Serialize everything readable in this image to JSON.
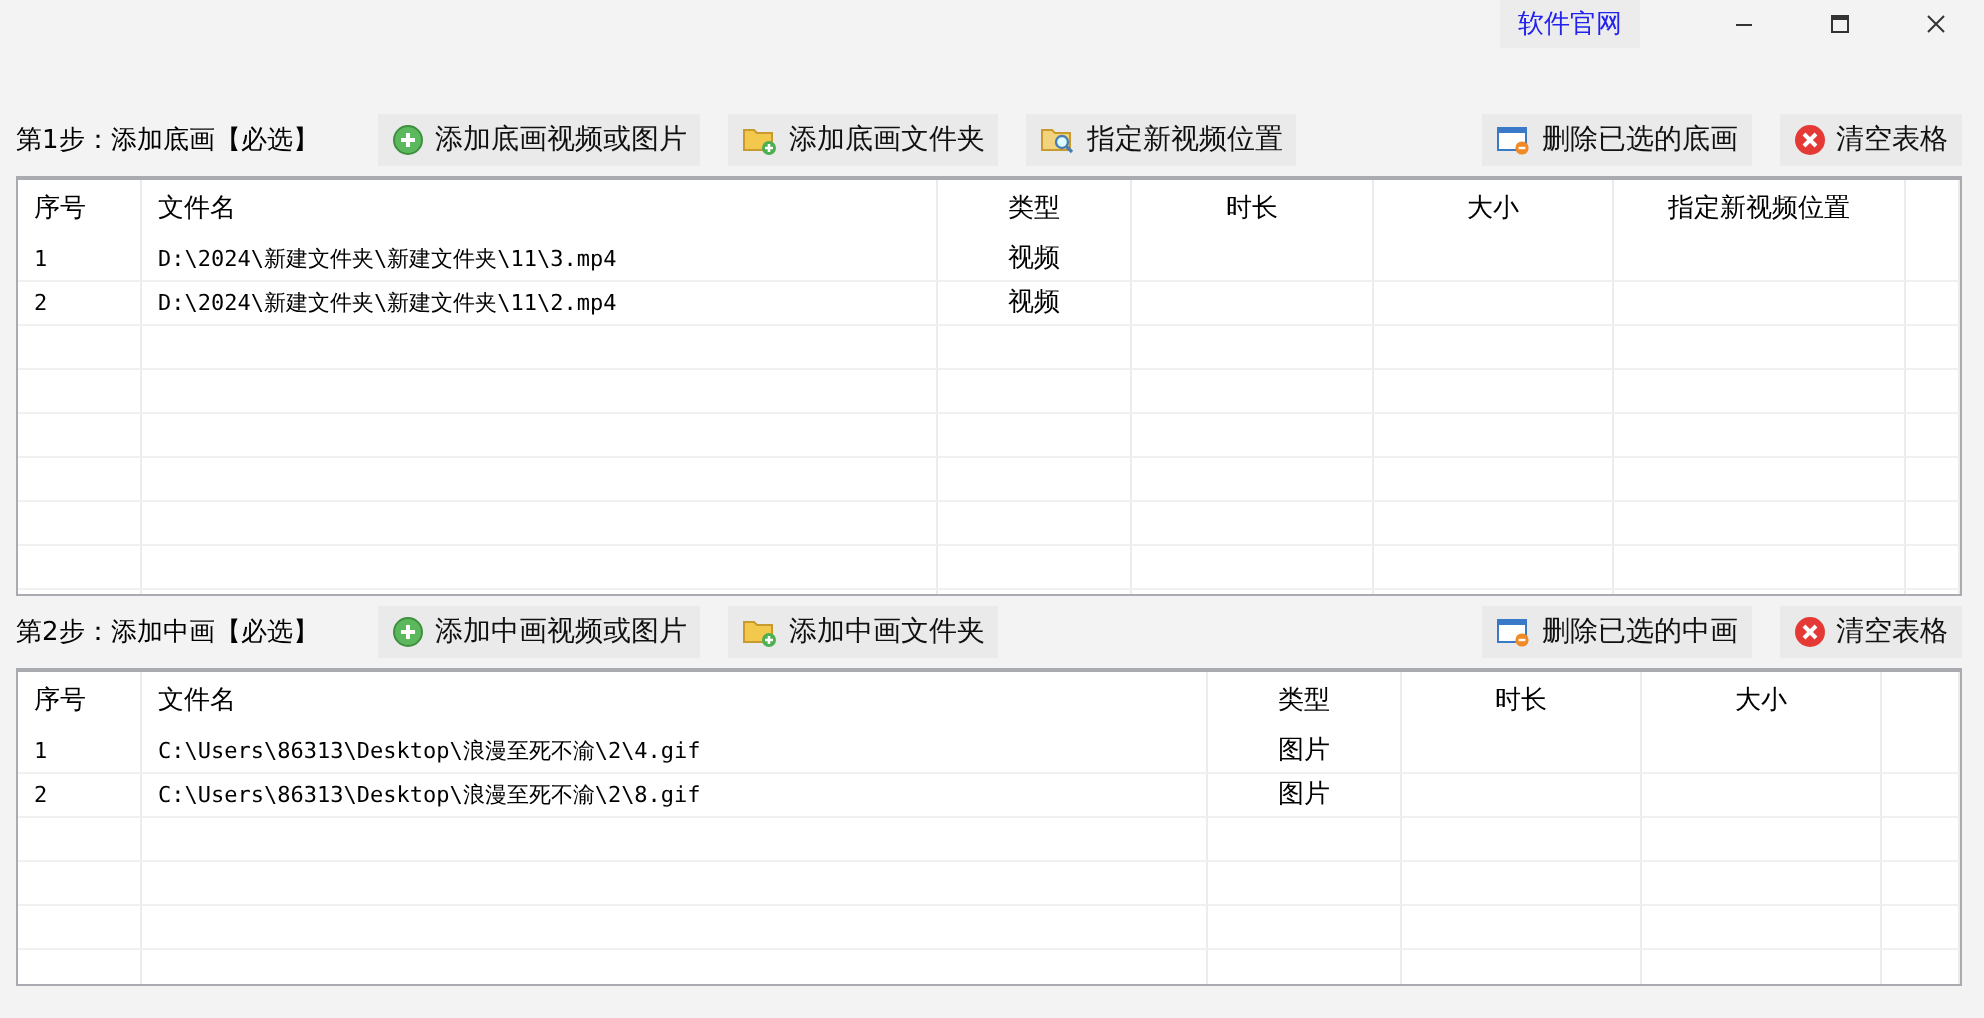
{
  "window": {
    "link": "软件官网"
  },
  "steps": [
    {
      "label": "第1步：添加底画【必选】",
      "left_buttons": [
        {
          "label": "添加底画视频或图片",
          "kind": "add"
        },
        {
          "label": "添加底画文件夹",
          "kind": "folder-add"
        },
        {
          "label": "指定新视频位置",
          "kind": "folder-search"
        }
      ],
      "right_buttons": [
        {
          "label": "删除已选的底画",
          "kind": "remove"
        },
        {
          "label": "清空表格",
          "kind": "clear"
        }
      ],
      "table": {
        "columns": [
          "序号",
          "文件名",
          "类型",
          "时长",
          "大小",
          "指定新视频位置"
        ],
        "rows": [
          [
            "1",
            "D:\\2024\\新建文件夹\\新建文件夹\\11\\3.mp4",
            "视频"
          ],
          [
            "2",
            "D:\\2024\\新建文件夹\\新建文件夹\\11\\2.mp4",
            "视频"
          ]
        ]
      }
    },
    {
      "label": "第2步：添加中画【必选】",
      "left_buttons": [
        {
          "label": "添加中画视频或图片",
          "kind": "add"
        },
        {
          "label": "添加中画文件夹",
          "kind": "folder-add"
        }
      ],
      "right_buttons": [
        {
          "label": "删除已选的中画",
          "kind": "remove"
        },
        {
          "label": "清空表格",
          "kind": "clear"
        }
      ],
      "table": {
        "columns": [
          "序号",
          "文件名",
          "类型",
          "时长",
          "大小"
        ],
        "rows": [
          [
            "1",
            "C:\\Users\\86313\\Desktop\\浪漫至死不渝\\2\\4.gif",
            "图片"
          ],
          [
            "2",
            "C:\\Users\\86313\\Desktop\\浪漫至死不渝\\2\\8.gif",
            "图片"
          ]
        ]
      }
    }
  ]
}
